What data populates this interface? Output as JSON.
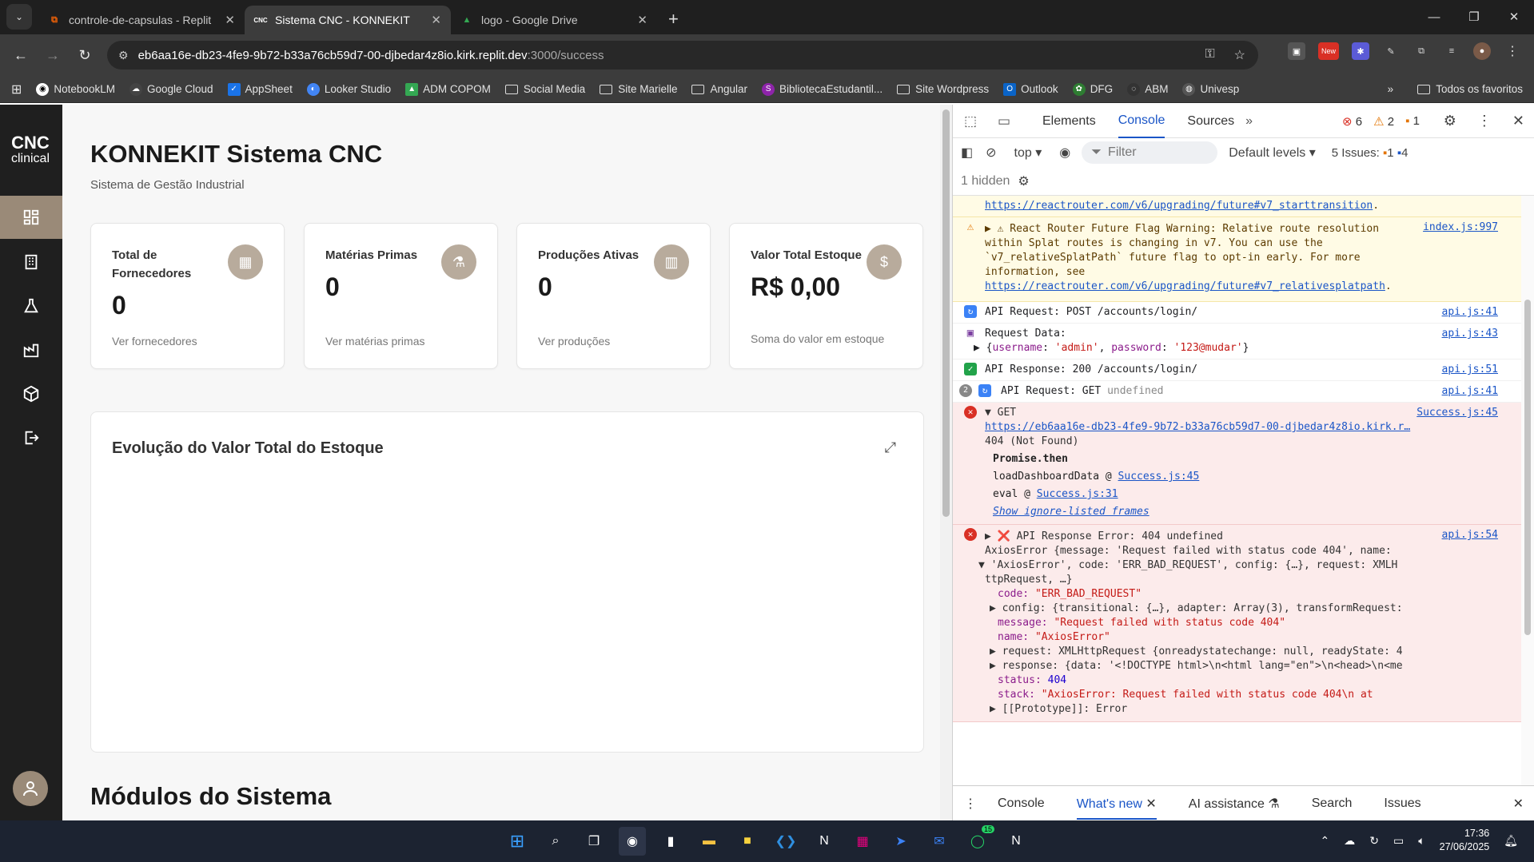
{
  "browser": {
    "tabs": [
      {
        "title": "controle-de-capsulas - Replit",
        "active": false,
        "favicon": "replit-icon"
      },
      {
        "title": "Sistema CNC - KONNEKIT",
        "active": true,
        "favicon": "cnc-icon"
      },
      {
        "title": "logo - Google Drive",
        "active": false,
        "favicon": "drive-icon"
      }
    ],
    "url_host": "eb6aa16e-db23-4fe9-9b72-b33a76cb59d7-00-djbedar4z8io.kirk.replit.dev",
    "url_path": ":3000/success",
    "bookmarks": [
      "NotebookLM",
      "Google Cloud",
      "AppSheet",
      "Looker Studio",
      "ADM COPOM",
      "Social Media",
      "Site Marielle",
      "Angular",
      "BibliotecaEstudantil...",
      "Site Wordpress",
      "Outlook",
      "DFG",
      "ABM",
      "Univesp"
    ],
    "all_bookmarks": "Todos os favoritos",
    "ext_badge": "New"
  },
  "app": {
    "logo_main": "CNC",
    "logo_sub": "clinical",
    "title": "KONNEKIT Sistema CNC",
    "subtitle": "Sistema de Gestão Industrial",
    "cards": [
      {
        "title": "Total de Fornecedores",
        "value": "0",
        "link": "Ver fornecedores",
        "icon": "building-icon"
      },
      {
        "title": "Matérias Primas",
        "value": "0",
        "link": "Ver matérias primas",
        "icon": "flask-icon"
      },
      {
        "title": "Produções Ativas",
        "value": "0",
        "link": "Ver produções",
        "icon": "factory-icon"
      },
      {
        "title": "Valor Total Estoque",
        "value": "R$ 0,00",
        "link": "Soma do valor em estoque",
        "icon": "dollar-icon"
      }
    ],
    "chart_title": "Evolução do Valor Total do Estoque",
    "modules_title": "Módulos do Sistema"
  },
  "devtools": {
    "tabs": [
      "Elements",
      "Console",
      "Sources"
    ],
    "active_tab": "Console",
    "errors": "6",
    "warnings": "2",
    "issues_count": "1",
    "context": "top",
    "filter_placeholder": "Filter",
    "levels": "Default levels",
    "issues_label": "5 Issues:",
    "issues_a": "1",
    "issues_b": "4",
    "hidden": "1 hidden",
    "messages": {
      "m0_link": "https://reactrouter.com/v6/upgrading/future#v7_starttransition",
      "m1_text": "▶ ⚠ React Router Future Flag Warning: Relative route resolution within Splat routes is changing in v7. You can use the `v7_relativeSplatPath` future flag to opt-in early. For more information, see",
      "m1_link": "https://reactrouter.com/v6/upgrading/future#v7_relativesplatpath",
      "m1_src": "index.js:997",
      "m1_tail": ".",
      "m2_text": "API Request: POST /accounts/login/",
      "m2_src": "api.js:41",
      "m3_text": "Request Data:",
      "m3_src": "api.js:43",
      "m3_obj_open": "▶ {",
      "m3_k1": "username",
      "m3_v1": "'admin'",
      "m3_k2": "password",
      "m3_v2": "'123@mudar'",
      "m3_obj_close": "}",
      "m4_text": "API Response: 200 /accounts/login/",
      "m4_src": "api.js:51",
      "m5_count": "2",
      "m5_text": "API Request: GET",
      "m5_undef": "undefined",
      "m5_src": "api.js:41",
      "m6_text": "▼ GET",
      "m6_src": "Success.js:45",
      "m6_url": "https://eb6aa16e-db23-4fe9-9b72-b33a76cb59d7-00-djbedar4z8io.kirk.r…",
      "m6_status": "404 (Not Found)",
      "m6_promise": "Promise.then",
      "m6_f1": "loadDashboardData @",
      "m6_f1l": "Success.js:45",
      "m6_f2": "eval @",
      "m6_f2l": "Success.js:31",
      "m6_show": "Show ignore-listed frames",
      "m7_text": "▶ ❌ API Response Error: 404 undefined",
      "m7_src": "api.js:54",
      "m7_l1": "AxiosError {message: 'Request failed with status code 404', name:",
      "m7_l2": "▼ 'AxiosError', code: 'ERR_BAD_REQUEST', config: {…}, request: XMLH",
      "m7_l3": "ttpRequest, …}",
      "m7_code_k": "code:",
      "m7_code_v": "\"ERR_BAD_REQUEST\"",
      "m7_config": "▶ config: {transitional: {…}, adapter: Array(3), transformRequest:",
      "m7_msg_k": "message:",
      "m7_msg_v": "\"Request failed with status code 404\"",
      "m7_name_k": "name:",
      "m7_name_v": "\"AxiosError\"",
      "m7_req": "▶ request: XMLHttpRequest {onreadystatechange: null, readyState: 4",
      "m7_resp": "▶ response: {data: '<!DOCTYPE html>\\n<html lang=\"en\">\\n<head>\\n<me",
      "m7_status_k": "status:",
      "m7_status_v": "404",
      "m7_stack_k": "stack:",
      "m7_stack_v": "\"AxiosError: Request failed with status code 404\\n    at",
      "m7_proto": "▶ [[Prototype]]: Error"
    },
    "drawer": [
      "Console",
      "What's new",
      "AI assistance",
      "Search",
      "Issues"
    ],
    "drawer_active": "What's new"
  },
  "taskbar": {
    "time": "17:36",
    "date": "27/06/2025",
    "whatsapp_badge": "15"
  }
}
